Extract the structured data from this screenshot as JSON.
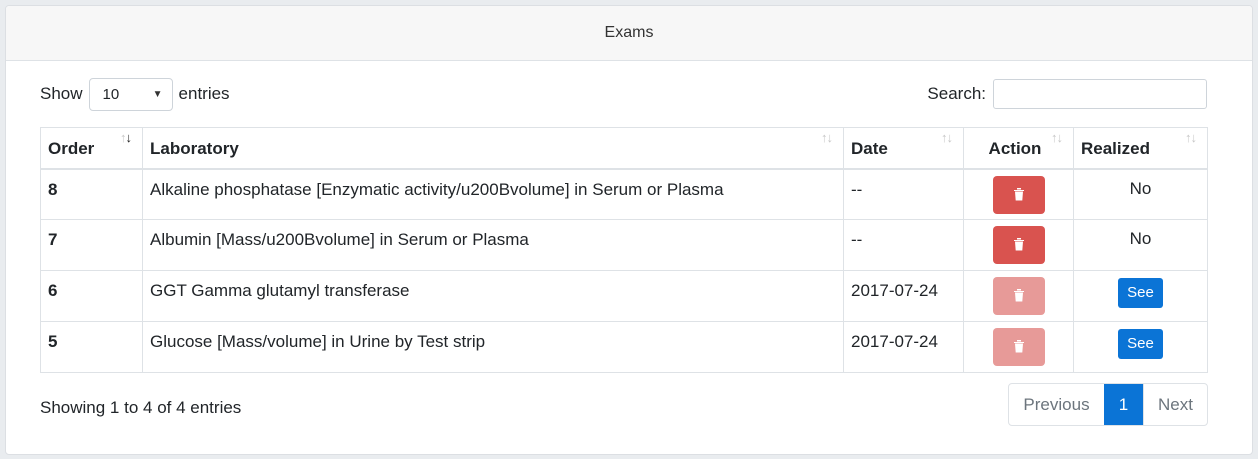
{
  "card": {
    "title": "Exams"
  },
  "length": {
    "show_label": "Show",
    "selected": "10",
    "entries_label": "entries"
  },
  "search": {
    "label": "Search:",
    "value": "",
    "placeholder": ""
  },
  "table": {
    "headers": [
      "Order",
      "Laboratory",
      "Date",
      "Action",
      "Realized"
    ],
    "rows": [
      {
        "order": "8",
        "laboratory": "Alkaline phosphatase [Enzymatic activity/u200Bvolume] in Serum or Plasma",
        "date": "--",
        "action_disabled": false,
        "realized": "No",
        "realized_type": "text"
      },
      {
        "order": "7",
        "laboratory": "Albumin [Mass/u200Bvolume] in Serum or Plasma",
        "date": "--",
        "action_disabled": false,
        "realized": "No",
        "realized_type": "text"
      },
      {
        "order": "6",
        "laboratory": "GGT Gamma glutamyl transferase",
        "date": "2017-07-24",
        "action_disabled": true,
        "realized": "See",
        "realized_type": "button"
      },
      {
        "order": "5",
        "laboratory": "Glucose [Mass/volume] in Urine by Test strip",
        "date": "2017-07-24",
        "action_disabled": true,
        "realized": "See",
        "realized_type": "button"
      }
    ]
  },
  "footer": {
    "info": "Showing 1 to 4 of 4 entries"
  },
  "pagination": {
    "previous": "Previous",
    "current": "1",
    "next": "Next"
  },
  "colors": {
    "delete": "#d9534f",
    "delete_disabled": "#e79a98",
    "primary": "#0b74d6"
  },
  "icons": {
    "delete": "trash-icon",
    "sort": "sort-arrows-icon"
  }
}
